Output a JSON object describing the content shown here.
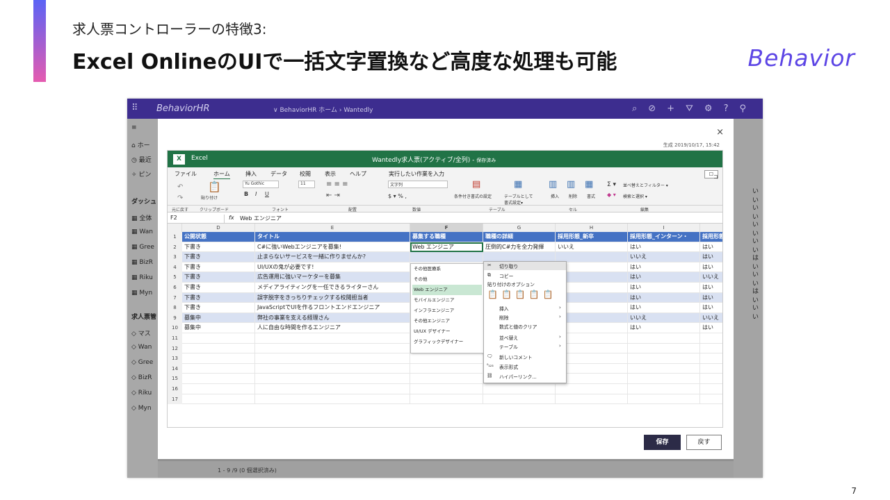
{
  "slide": {
    "subtitle": "求人票コントローラーの特徴3:",
    "title": "Excel OnlineのUIで一括文字置換など高度な処理も可能",
    "logo": "Behavior",
    "page": "7"
  },
  "powerapps": {
    "brand": "BehaviorHR",
    "breadcrumb": "∨  BehaviorHR  ホーム  ›  Wantedly",
    "footer": "1 - 9 /9 (0 個選択済み)",
    "sidebar": [
      "ホー",
      "最近",
      "ピン",
      "ダッシュ",
      "全体",
      "Wan",
      "Gree",
      "BizR",
      "Riku",
      "Myn",
      "求人票管",
      "マス",
      "Wan",
      "Gree",
      "BizR",
      "Riku",
      "Myn"
    ],
    "right_values": [
      "いい",
      "いい",
      "いい",
      "いい",
      "はい",
      "いい",
      "はい",
      "いい"
    ]
  },
  "dialog": {
    "close": "×",
    "generated": "生成 2019/10/17, 15:42",
    "save": "保存",
    "back": "戻す"
  },
  "excel": {
    "app": "Excel",
    "doc_title": "Wantedly求人票(アクティブ/全列)  -",
    "doc_status": "保存済み",
    "menu": [
      "ファイル",
      "ホーム",
      "挿入",
      "データ",
      "校閲",
      "表示",
      "ヘルプ",
      "実行したい作業を入力"
    ],
    "comment": "コメント",
    "ribbon": {
      "undo": "元に戻す",
      "paste": "貼り付け",
      "font": "Yu Gothic",
      "size": "11",
      "bold": "B",
      "italic": "I",
      "underline": "U",
      "numfmt": "文字列",
      "pct": "$ ▾ %  ,",
      "condfmt": "条件付き書式の設定",
      "tablefmt": "テーブルとして\n書式設定▾",
      "insert": "挿入",
      "delete": "削除",
      "format": "書式",
      "sort": "並べ替えとフィルター ▾",
      "find": "検索と選択 ▾"
    },
    "groups": [
      "元に戻す",
      "クリップボード",
      "フォント",
      "配置",
      "数値",
      "テーブル",
      "セル",
      "編集"
    ],
    "namebox": "F2",
    "formula": "Web エンジニア",
    "columns": [
      "D",
      "E",
      "F",
      "G",
      "H",
      "I"
    ],
    "header_row": [
      "公開状態",
      "タイトル",
      "募集する職種",
      "職種の詳細",
      "採用形態_新卒",
      "採用形態_インターン・",
      "採用形態_"
    ],
    "rows": [
      [
        "下書き",
        "C#に強いWebエンジニアを募集!",
        "Web エンジニア",
        "圧倒的C#力を全力発揮",
        "いいえ",
        "はい",
        "はい"
      ],
      [
        "下書き",
        "止まらないサービスを一緒に作りませんか?",
        "",
        "",
        "",
        "いいえ",
        "はい"
      ],
      [
        "下書き",
        "UI/UXの鬼が必要です!",
        "",
        "",
        "え",
        "はい",
        "はい"
      ],
      [
        "下書き",
        "広告運用に強いマーケターを募集",
        "",
        "",
        "",
        "はい",
        "いいえ"
      ],
      [
        "下書き",
        "メディアライティングを一任できるライターさん",
        "",
        "",
        "え",
        "はい",
        "はい"
      ],
      [
        "下書き",
        "誤字脱字をきっちりチェックする校閲担当者",
        "",
        "",
        "",
        "はい",
        "はい"
      ],
      [
        "下書き",
        "JavaScriptでUIを作るフロントエンドエンジニア",
        "",
        "",
        "え",
        "はい",
        "はい"
      ],
      [
        "募集中",
        "弊社の事業を支える経理さん",
        "",
        "",
        "",
        "いいえ",
        "いいえ"
      ],
      [
        "募集中",
        "人に自由な時間を作るエンジニア",
        "",
        "",
        "え",
        "はい",
        "はい"
      ]
    ],
    "row_numbers": [
      "1",
      "2",
      "3",
      "4",
      "5",
      "6",
      "7",
      "8",
      "9",
      "10",
      "11",
      "12",
      "13",
      "14",
      "15",
      "16",
      "17"
    ],
    "dropdown": [
      "その他医療系",
      "その他",
      "Web エンジニア",
      "モバイルエンジニア",
      "インフラエンジニア",
      "その他エンジニア",
      "UI/UX デザイナー",
      "グラフィックデザイナー"
    ],
    "context": {
      "cut": "切り取り",
      "copy": "コピー",
      "paste_opts": "貼り付けのオプション",
      "insert": "挿入",
      "delete": "削除",
      "clear": "数式と値のクリア",
      "sort": "並べ替え",
      "table": "テーブル",
      "new_comment": "新しいコメント",
      "numfmt": "表示形式",
      "link": "ハイパーリンク..."
    }
  }
}
